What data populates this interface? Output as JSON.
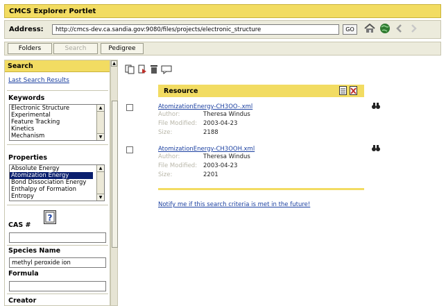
{
  "portlet": {
    "title": "CMCS Explorer Portlet"
  },
  "address": {
    "label": "Address:",
    "url": "http://cmcs-dev.ca.sandia.gov:9080/files/projects/electronic_structure",
    "go_label": "GO",
    "icons": [
      "home-icon",
      "globe-icon",
      "back-arrow-icon",
      "forward-arrow-icon"
    ]
  },
  "tabs": [
    {
      "label": "Folders",
      "enabled": true
    },
    {
      "label": "Search",
      "enabled": false
    },
    {
      "label": "Pedigree",
      "enabled": true
    }
  ],
  "sidebar": {
    "header": "Search",
    "last_results_link": "Last Search Results",
    "keywords": {
      "label": "Keywords",
      "items": [
        "Electronic Structure",
        "Experimental",
        "Feature Tracking",
        "Kinetics",
        "Mechanism"
      ]
    },
    "properties": {
      "label": "Properties",
      "items": [
        "Absolute Energy",
        "Atomization Energy",
        "Bond Dissociation Energy",
        "Enthalpy of Formation",
        "Entropy"
      ],
      "selected": "Atomization Energy"
    },
    "cas": {
      "label": "CAS #",
      "value": ""
    },
    "species": {
      "label": "Species Name",
      "value": "methyl peroxide ion"
    },
    "formula": {
      "label": "Formula",
      "value": ""
    },
    "creator": {
      "label": "Creator"
    }
  },
  "toolbar": {
    "icons": [
      "copy-icon",
      "paste-icon",
      "delete-icon",
      "comment-icon"
    ]
  },
  "results": {
    "header": "Resource",
    "header_icons": [
      "document-icon",
      "delete-document-icon"
    ],
    "field_labels": {
      "author": "Author:",
      "modified": "File Modified:",
      "size": "Size:"
    },
    "items": [
      {
        "name": "AtomizationEnergy-CH3OO-.xml",
        "author": "Theresa Windus",
        "modified": "2003-04-23",
        "size": "2188"
      },
      {
        "name": "AtomizationEnergy-CH3OOH.xml",
        "author": "Theresa Windus",
        "modified": "2003-04-23",
        "size": "2201"
      }
    ],
    "notify_link": "Notify me if this search criteria is met in the future!"
  }
}
